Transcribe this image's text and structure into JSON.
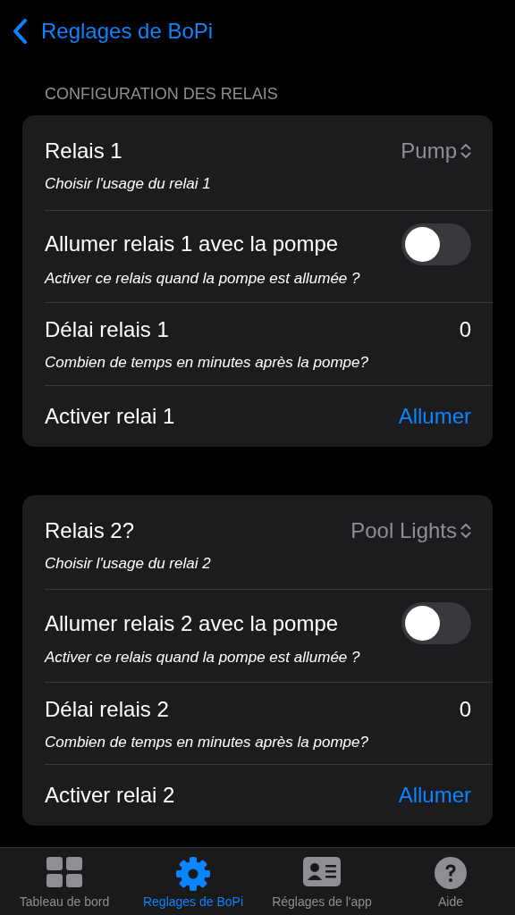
{
  "nav": {
    "back_label": "Reglages de BoPi"
  },
  "section_header": "CONFIGURATION DES RELAIS",
  "cards": [
    {
      "rows": [
        {
          "kind": "picker",
          "label": "Relais 1",
          "value": "Pump",
          "caption": "Choisir l'usage du relai 1"
        },
        {
          "kind": "toggle",
          "label": "Allumer relais 1 avec la pompe",
          "on": false,
          "caption": "Activer ce relais quand la pompe est allumée ?"
        },
        {
          "kind": "value",
          "label": "Délai relais 1",
          "value": "0",
          "caption": "Combien de temps en minutes après la pompe?"
        },
        {
          "kind": "action",
          "label": "Activer relai 1",
          "action": "Allumer"
        }
      ]
    },
    {
      "rows": [
        {
          "kind": "picker",
          "label": "Relais 2?",
          "value": "Pool Lights",
          "caption": "Choisir l'usage du relai 2"
        },
        {
          "kind": "toggle",
          "label": "Allumer relais 2 avec la pompe",
          "on": false,
          "caption": "Activer ce relais quand la pompe est allumée ?"
        },
        {
          "kind": "value",
          "label": "Délai relais 2",
          "value": "0",
          "caption": "Combien de temps en minutes après la pompe?"
        },
        {
          "kind": "action",
          "label": "Activer relai 2",
          "action": "Allumer"
        }
      ]
    }
  ],
  "tab_bar": [
    {
      "label": "Tableau de bord",
      "selected": false
    },
    {
      "label": "Reglages de BoPi",
      "selected": true
    },
    {
      "label": "Réglages de l'app",
      "selected": false
    },
    {
      "label": "Aide",
      "selected": false
    }
  ]
}
